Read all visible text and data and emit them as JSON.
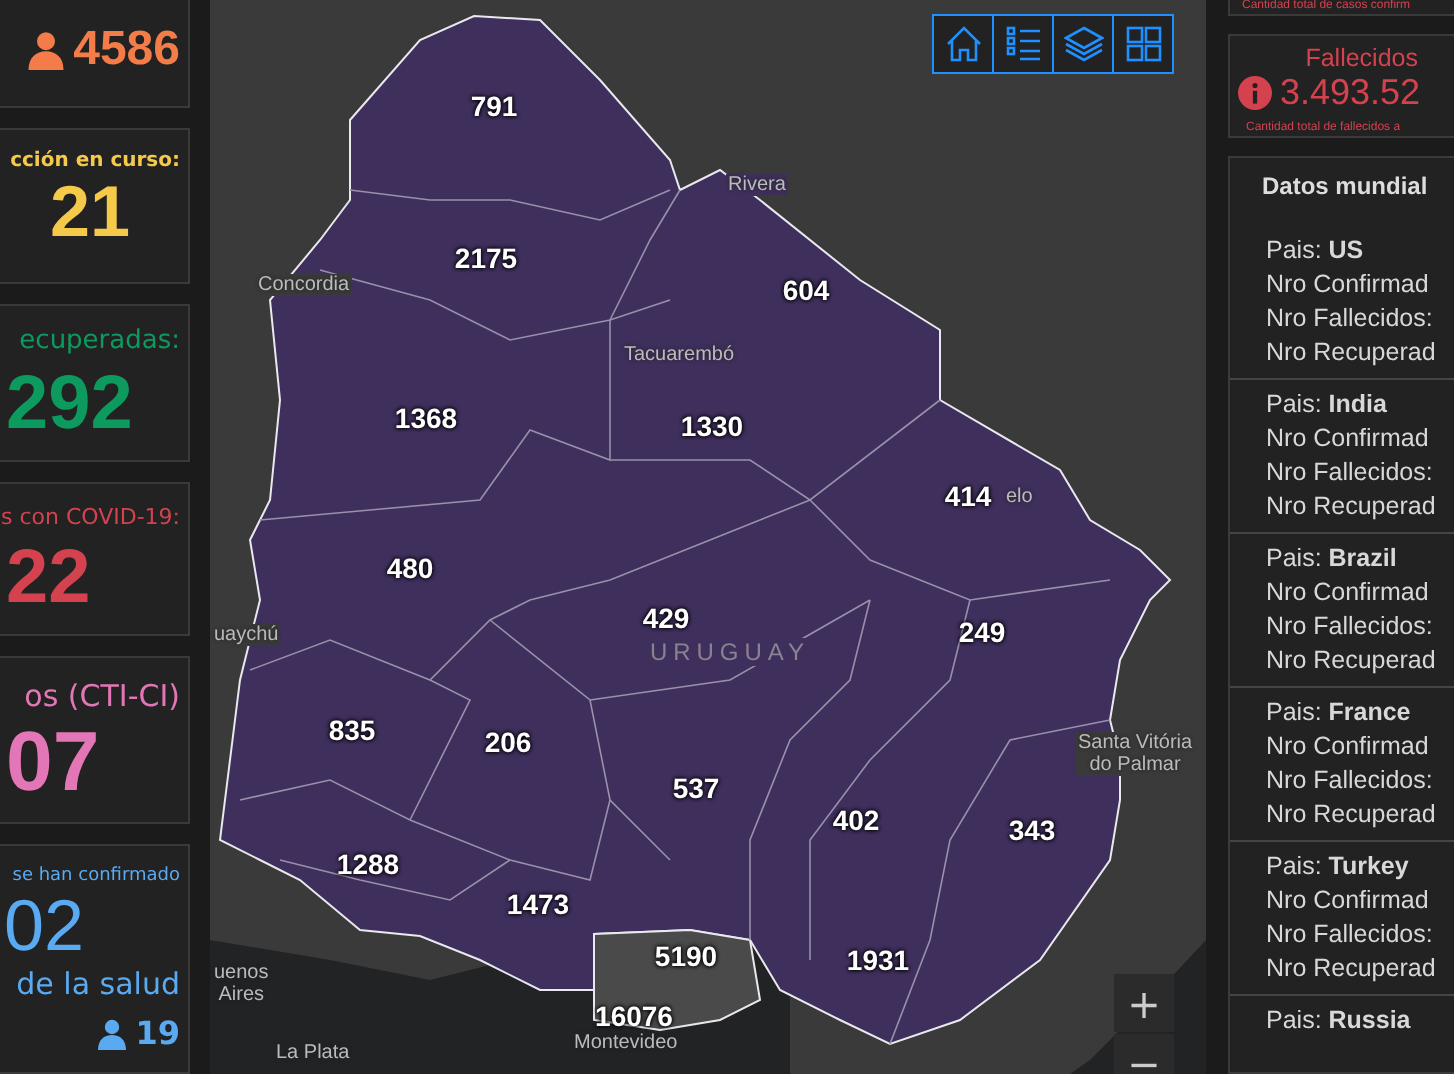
{
  "left_stats": [
    {
      "kind": "icon-value",
      "value": "4586",
      "color": "#f47c48"
    },
    {
      "kind": "labeled",
      "label": "cción en curso:",
      "value": "21",
      "color": "#f5c94a"
    },
    {
      "kind": "labeled",
      "label": "ecuperadas:",
      "value": "292",
      "color": "#0c9a5e"
    },
    {
      "kind": "labeled",
      "label": "s con COVID-19:",
      "value": "22",
      "color": "#d4424f"
    },
    {
      "kind": "labeled",
      "label": "os (CTI-CI)",
      "value": "07",
      "color": "#e276b6"
    },
    {
      "kind": "detail",
      "label": "se han confirmado",
      "value": "02",
      "sublabel": "de la salud",
      "footer": "19",
      "color": "#5aaaf2"
    }
  ],
  "map": {
    "department_counts": [
      "791",
      "2175",
      "604",
      "1368",
      "1330",
      "414",
      "480",
      "429",
      "249",
      "835",
      "206",
      "537",
      "402",
      "343",
      "1288",
      "1473",
      "5190",
      "1931",
      "16076"
    ],
    "place_labels": [
      "Rivera",
      "Concordia",
      "Tacuarembó",
      "elo",
      "uaychú",
      "Santa Vitória\ndo Palmar",
      "uenos\nAires",
      "La Plata",
      "Montevideo"
    ],
    "country_label": "URUGUAY",
    "zoom_controls": [
      "+",
      "−"
    ]
  },
  "confirmed_card": {
    "caption": "Cantidad total de casos confirm"
  },
  "deaths_card": {
    "label": "Fallecidos",
    "value": "3.493.52",
    "caption": "Cantidad total de fallecidos a"
  },
  "world": {
    "title": "Datos mundial",
    "countries": [
      {
        "heading": "Pais: **US**",
        "lines": [
          "Nro Confirmad",
          "Nro Fallecidos:",
          "Nro Recuperad"
        ]
      },
      {
        "heading": "Pais: **India**",
        "lines": [
          "Nro Confirmad",
          "Nro Fallecidos:",
          "Nro Recuperad"
        ]
      },
      {
        "heading": "Pais: **Brazil**",
        "lines": [
          "Nro Confirmad",
          "Nro Fallecidos:",
          "Nro Recuperad"
        ]
      },
      {
        "heading": "Pais: **France**",
        "lines": [
          "Nro Confirmad",
          "Nro Fallecidos:",
          "Nro Recuperad"
        ]
      },
      {
        "heading": "Pais: **Turkey**",
        "lines": [
          "Nro Confirmad",
          "Nro Fallecidos:",
          "Nro Recuperad"
        ]
      },
      {
        "heading": "Pais: **Russia**"
      }
    ]
  }
}
